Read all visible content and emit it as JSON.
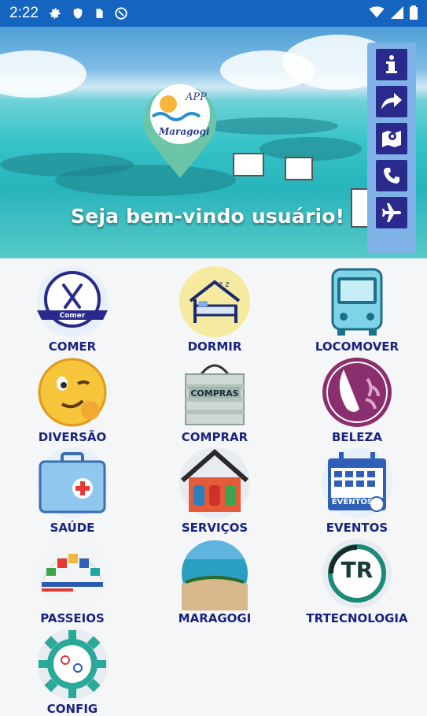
{
  "status": {
    "time": "2:22"
  },
  "hero": {
    "logo_top": "APP",
    "logo_bottom": "Maragogi",
    "welcome": "Seja bem-vindo usuário!"
  },
  "side_actions": [
    {
      "name": "info-icon"
    },
    {
      "name": "share-icon"
    },
    {
      "name": "map-icon"
    },
    {
      "name": "phone-icon"
    },
    {
      "name": "airplane-icon"
    }
  ],
  "menu": [
    {
      "label": "COMER",
      "icon": "cutlery-icon",
      "badge": "Comer"
    },
    {
      "label": "DORMIR",
      "icon": "bed-icon"
    },
    {
      "label": "LOCOMOVER",
      "icon": "bus-icon"
    },
    {
      "label": "DIVERSÃO",
      "icon": "wink-emoji-icon"
    },
    {
      "label": "COMPRAR",
      "icon": "shopping-bag-icon",
      "badge": "COMPRAS"
    },
    {
      "label": "BELEZA",
      "icon": "beauty-face-icon"
    },
    {
      "label": "SAÚDE",
      "icon": "first-aid-kit-icon"
    },
    {
      "label": "SERVIÇOS",
      "icon": "services-house-icon"
    },
    {
      "label": "EVENTOS",
      "icon": "calendar-icon",
      "badge": "EVENTOS"
    },
    {
      "label": "PASSEIOS",
      "icon": "tours-icon"
    },
    {
      "label": "MARAGOGI",
      "icon": "beach-photo-icon"
    },
    {
      "label": "TRTECNOLOGIA",
      "icon": "tr-logo-icon",
      "badge": "TR"
    },
    {
      "label": "CONFIG",
      "icon": "settings-gear-icon"
    }
  ],
  "colors": {
    "statusbar": "#1565c0",
    "label": "#1a237e",
    "side_button": "#2a2a8c",
    "side_panel": "#7fb3e8"
  }
}
